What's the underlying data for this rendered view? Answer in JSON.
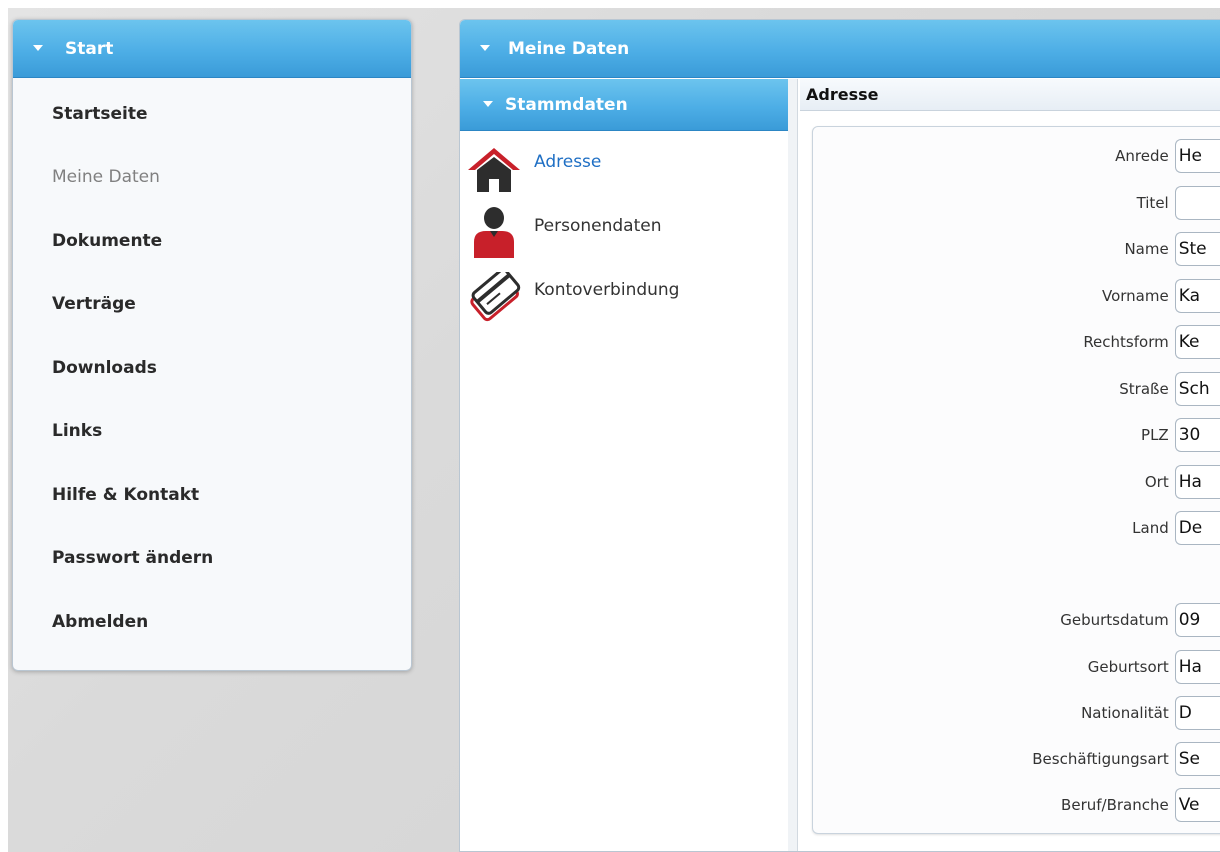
{
  "left_panel": {
    "header": "Start",
    "items": [
      {
        "label": "Startseite",
        "active": false
      },
      {
        "label": "Meine Daten",
        "active": true
      },
      {
        "label": "Dokumente",
        "active": false
      },
      {
        "label": "Verträge",
        "active": false
      },
      {
        "label": "Downloads",
        "active": false
      },
      {
        "label": "Links",
        "active": false
      },
      {
        "label": "Hilfe & Kontakt",
        "active": false
      },
      {
        "label": "Passwort ändern",
        "active": false
      },
      {
        "label": "Abmelden",
        "active": false
      }
    ]
  },
  "right_panel": {
    "header": "Meine Daten",
    "subnav": {
      "header": "Stammdaten",
      "items": [
        {
          "label": "Adresse",
          "icon": "house-icon",
          "active": true
        },
        {
          "label": "Personendaten",
          "icon": "person-icon",
          "active": false
        },
        {
          "label": "Kontoverbindung",
          "icon": "card-icon",
          "active": false
        }
      ]
    },
    "form": {
      "title": "Adresse",
      "fields": [
        {
          "label": "Anrede",
          "value": "He"
        },
        {
          "label": "Titel",
          "value": ""
        },
        {
          "label": "Name",
          "value": "Ste"
        },
        {
          "label": "Vorname",
          "value": "Ka"
        },
        {
          "label": "Rechtsform",
          "value": "Ke"
        },
        {
          "label": "Straße",
          "value": "Sch"
        },
        {
          "label": "PLZ",
          "value": "30"
        },
        {
          "label": "Ort",
          "value": "Ha"
        },
        {
          "label": "Land",
          "value": "De"
        },
        {
          "label": "Geburtsdatum",
          "value": "09"
        },
        {
          "label": "Geburtsort",
          "value": "Ha"
        },
        {
          "label": "Nationalität",
          "value": "D"
        },
        {
          "label": "Beschäftigungsart",
          "value": "Se"
        },
        {
          "label": "Beruf/Branche",
          "value": "Ve"
        }
      ]
    }
  },
  "colors": {
    "header_blue": "#4daee6",
    "active_link": "#1f6fc4",
    "icon_red": "#c8202a"
  }
}
